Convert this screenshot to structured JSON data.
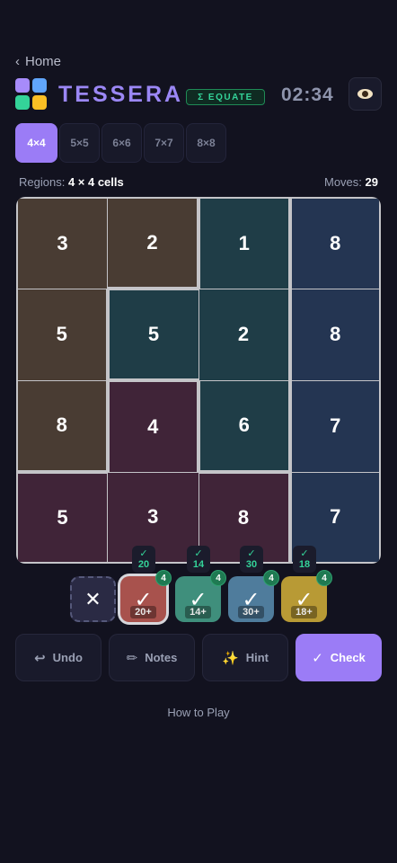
{
  "nav": {
    "back_label": "Home"
  },
  "header": {
    "title": "TESSERA",
    "mode_badge": "Σ EQUATE",
    "timer": "02:34"
  },
  "size_tabs": [
    {
      "label": "4×4",
      "active": true
    },
    {
      "label": "5×5",
      "active": false
    },
    {
      "label": "6×6",
      "active": false
    },
    {
      "label": "7×7",
      "active": false
    },
    {
      "label": "8×8",
      "active": false
    }
  ],
  "info": {
    "regions_label": "Regions:",
    "regions_value": "4 × 4 cells",
    "moves_label": "Moves:",
    "moves_value": "29"
  },
  "board": {
    "rows": 4,
    "cols": 4,
    "cells": [
      [
        "3",
        "2",
        "1",
        "8"
      ],
      [
        "5",
        "5",
        "2",
        "8"
      ],
      [
        "8",
        "4",
        "6",
        "7"
      ],
      [
        "5",
        "3",
        "8",
        "7"
      ]
    ],
    "region_map": [
      [
        "brown",
        "brown",
        "teal",
        "blue"
      ],
      [
        "brown",
        "teal",
        "teal",
        "blue"
      ],
      [
        "brown",
        "maroon",
        "teal",
        "blue"
      ],
      [
        "maroon",
        "maroon",
        "maroon",
        "blue"
      ]
    ],
    "region_colors": {
      "brown": "#493c33",
      "teal": "#1f3d47",
      "blue": "#243552",
      "maroon": "#402438"
    }
  },
  "chips": {
    "clear_symbol": "✕",
    "items": [
      {
        "target": "20",
        "label": "20+",
        "count": "4",
        "done": "✓",
        "color": "#a8524d",
        "selected": true
      },
      {
        "target": "14",
        "label": "14+",
        "count": "4",
        "done": "✓",
        "color": "#3f8f7c",
        "selected": false
      },
      {
        "target": "30",
        "label": "30+",
        "count": "4",
        "done": "✓",
        "color": "#4f7c9c",
        "selected": false
      },
      {
        "target": "18",
        "label": "18+",
        "count": "4",
        "done": "✓",
        "color": "#b89a35",
        "selected": false
      }
    ]
  },
  "actions": {
    "undo": {
      "icon": "↩",
      "label": "Undo"
    },
    "notes": {
      "icon": "✏",
      "label": "Notes"
    },
    "hint": {
      "icon": "✨",
      "label": "Hint"
    },
    "check": {
      "icon": "✓",
      "label": "Check"
    }
  },
  "footer": {
    "how_to_play": "How to Play"
  },
  "colors": {
    "accent": "#9b7cf6",
    "success": "#34d399",
    "background": "#12121f"
  }
}
